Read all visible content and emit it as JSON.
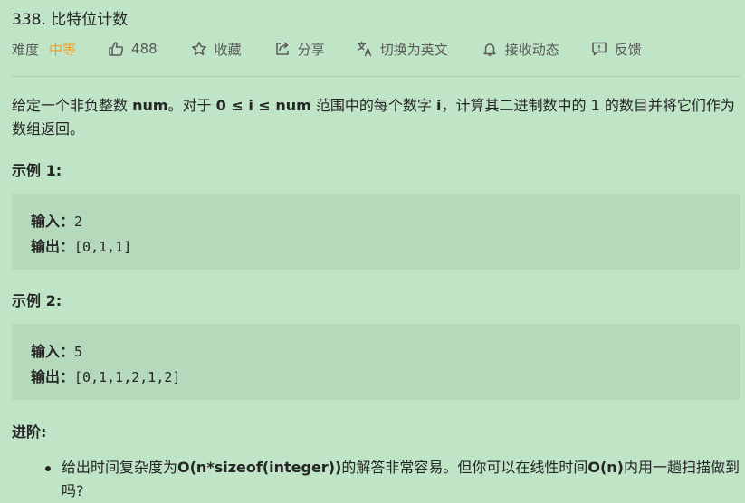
{
  "problem": {
    "title": "338. 比特位计数"
  },
  "meta": {
    "difficulty_label": "难度",
    "difficulty_value": "中等",
    "likes_count": "488",
    "favorite_label": "收藏",
    "share_label": "分享",
    "switch_language_label": "切换为英文",
    "subscribe_label": "接收动态",
    "feedback_label": "反馈"
  },
  "description": {
    "part1": "给定一个非负整数 ",
    "num1": "num",
    "part2": "。对于 ",
    "range": "0 ≤ i ≤ num",
    "part3": " 范围中的每个数字 ",
    "i": "i",
    "part4": "，计算其二进制数中的 1 的数目并将它们作为数组返回。"
  },
  "examples": [
    {
      "heading": "示例 1:",
      "input_label": "输入：",
      "input_value": "2",
      "output_label": "输出：",
      "output_value": "[0,1,1]"
    },
    {
      "heading": "示例 2:",
      "input_label": "输入：",
      "input_value": "5",
      "output_label": "输出：",
      "output_value": "[0,1,1,2,1,2]"
    }
  ],
  "advanced": {
    "heading": "进阶:",
    "text_before": "给出时间复杂度为",
    "complexity1": "O(n*sizeof(integer))",
    "text_middle": "的解答非常容易。但你可以在线性时间",
    "complexity2": "O(n)",
    "text_after": "内用一趟扫描做到吗?"
  },
  "colors": {
    "background": "#c0e4c6",
    "code_block": "#b5dabb",
    "difficulty_medium": "#ef9d2a"
  },
  "icons": [
    "thumbs-up-icon",
    "star-icon",
    "share-icon",
    "translate-icon",
    "bell-icon",
    "feedback-icon"
  ]
}
